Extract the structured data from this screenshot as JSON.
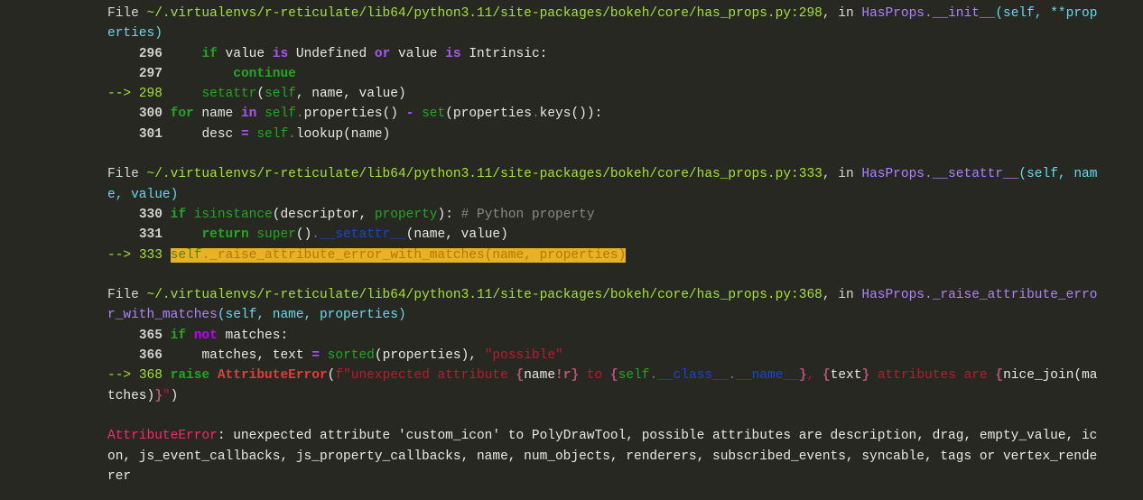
{
  "traceback": {
    "frame1": {
      "file_label": "File ",
      "path": "~/.virtualenvs/r-reticulate/lib64/python3.11/site-packages/bokeh/core/has_props.py",
      "lineno": ":298",
      "in_label": ", in ",
      "func_line1": "HasProps.__init__",
      "args_line1": "(self, **prop",
      "args_line2": "erties)",
      "code": {
        "l296": {
          "num": "296",
          "indent": "    ",
          "kw_if": "if",
          "t1": " value ",
          "op_is": "is",
          "t2": " Undefined ",
          "op_or": "or",
          "t3": " value ",
          "op_is2": "is",
          "t4": " Intrinsic:"
        },
        "l297": {
          "num": "297",
          "indent": "        ",
          "kw_continue": "continue"
        },
        "l298": {
          "arrow": "--> ",
          "num": "298",
          "indent": "    ",
          "bi_setattr": "setattr",
          "t1": "(",
          "self": "self",
          "t2": ", name, value)"
        },
        "l300": {
          "num": "300",
          "kw_for": "for",
          "t1": " name ",
          "op_in": "in",
          "t2": " ",
          "self": "self",
          "dot": ".",
          "t3": "properties() ",
          "minus": "-",
          "t4": " ",
          "bi_set": "set",
          "t5": "(properties",
          "dot2": ".",
          "t6": "keys()):"
        },
        "l301": {
          "num": "301",
          "indent": "    ",
          "t1": "desc ",
          "eq": "=",
          "t2": " ",
          "self": "self",
          "dot": ".",
          "t3": "lookup(name)"
        }
      }
    },
    "frame2": {
      "file_label": "File ",
      "path": "~/.virtualenvs/r-reticulate/lib64/python3.11/site-packages/bokeh/core/has_props.py",
      "lineno": ":333",
      "in_label": ", in ",
      "func_line1": "HasProps.__setattr__",
      "args_line1": "(self, nam",
      "args_line2": "e, value)",
      "code": {
        "l330": {
          "num": "330",
          "kw_if": "if",
          "t1": " ",
          "bi_isinstance": "isinstance",
          "t2": "(descriptor, ",
          "bi_property": "property",
          "t3": "): ",
          "comment": "# Python property"
        },
        "l331": {
          "num": "331",
          "indent": "    ",
          "kw_return": "return",
          "t1": " ",
          "bi_super": "super",
          "t2": "()",
          "dot": ".",
          "dunder": "__setattr__",
          "t3": "(name, value)"
        },
        "l333": {
          "arrow": "--> ",
          "num": "333",
          "self": "self",
          "hl_rest": "._raise_attribute_error_with_matches(name, properties)"
        }
      }
    },
    "frame3": {
      "file_label": "File ",
      "path": "~/.virtualenvs/r-reticulate/lib64/python3.11/site-packages/bokeh/core/has_props.py",
      "lineno": ":368",
      "in_label": ", in ",
      "func_line1": "HasProps._raise_attribute_erro",
      "func_line2": "r_with_matches",
      "args_line2": "(self, name, properties)",
      "code": {
        "l365": {
          "num": "365",
          "kw_if": "if",
          "t1": " ",
          "op_not": "not",
          "t2": " matches:"
        },
        "l366": {
          "num": "366",
          "indent": "    ",
          "t1": "matches, text ",
          "eq": "=",
          "t2": " ",
          "bi_sorted": "sorted",
          "t3": "(properties), ",
          "str": "\"possible\""
        },
        "l368": {
          "arrow": "--> ",
          "num": "368",
          "kw_raise": "raise",
          "t1": " ",
          "exc": "AttributeError",
          "t2": "(",
          "s1": "f\"unexpected attribute ",
          "b1": "{",
          "v1": "name",
          "b2": "!r}",
          "s2": " to ",
          "b3": "{",
          "self": "self",
          "dot1": ".",
          "dunder1": "__class__",
          "dot2": ".",
          "dunder2": "__name__",
          "b4": "}",
          "s3": ", ",
          "b5": "{",
          "v2": "text",
          "b6": "}",
          "s4": " attributes are ",
          "b7": "{",
          "v3": "nice_join(ma",
          "cont_v3": "tches)",
          "cont_b8": "}",
          "cont_s5": "\"",
          "cont_t3": ")"
        }
      }
    },
    "error": {
      "name": "AttributeError",
      "message_line1": ": unexpected attribute 'custom_icon' to PolyDrawTool, possible attributes are description, drag, empty_value, ic",
      "message_line2": "on, js_event_callbacks, js_property_callbacks, name, num_objects, renderers, subscribed_events, syncable, tags or vertex_rende",
      "message_line3": "rer"
    }
  }
}
